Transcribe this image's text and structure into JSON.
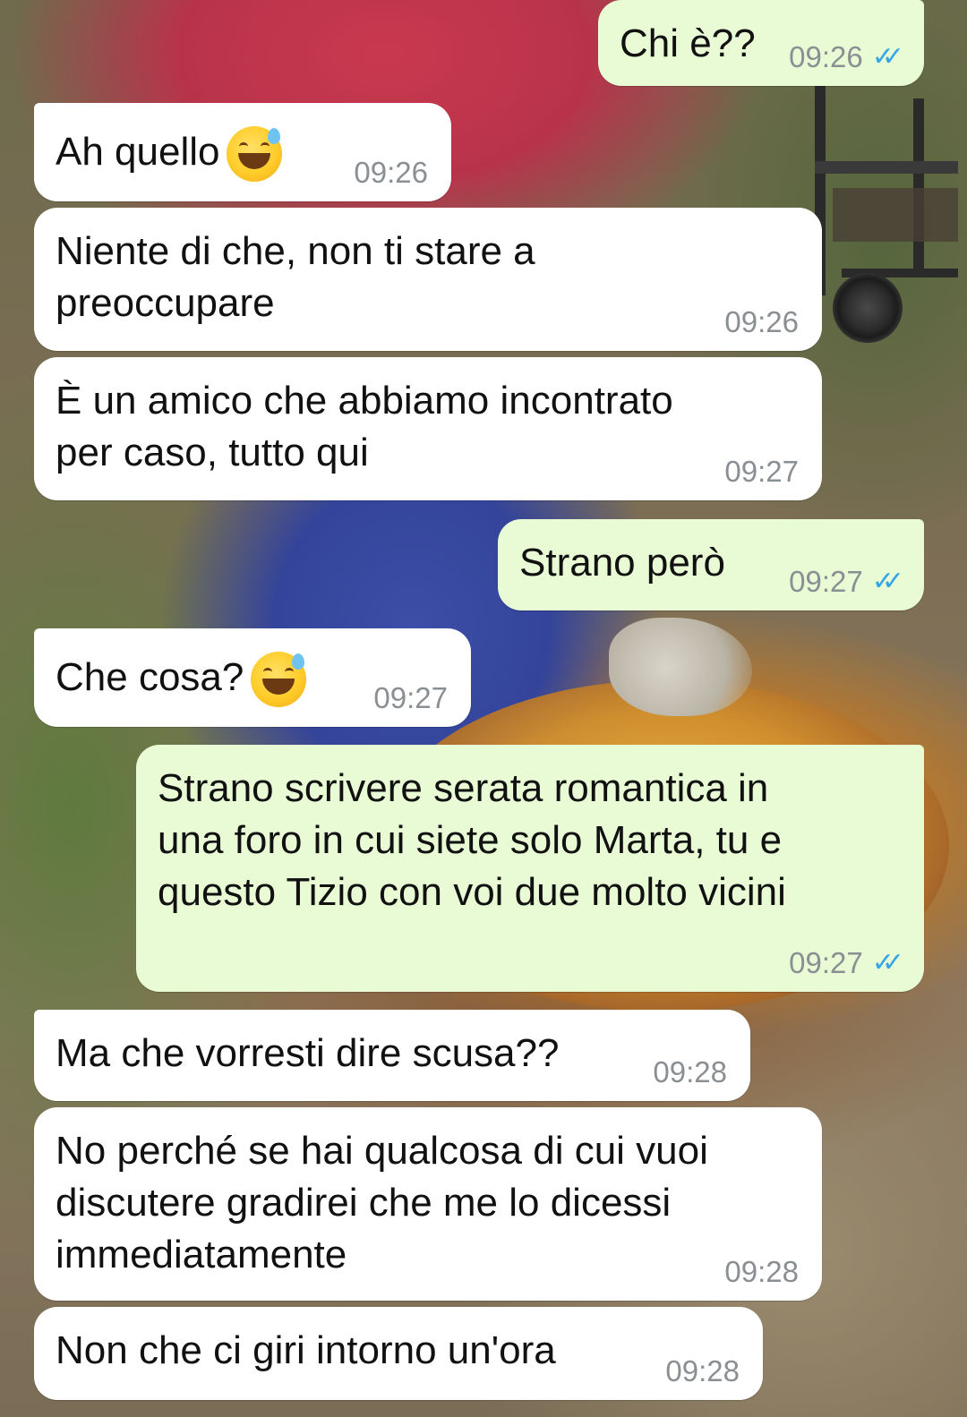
{
  "messages": [
    {
      "direction": "out",
      "text": "Chi è??",
      "time": "09:26",
      "ticks": "✓✓"
    },
    {
      "direction": "in",
      "text": "Ah quello",
      "emoji": "grinning-sweat-emoji",
      "time": "09:26"
    },
    {
      "direction": "in",
      "text": "Niente di che, non ti stare a\npreoccupare",
      "time": "09:26"
    },
    {
      "direction": "in",
      "text": "È un amico che abbiamo incontrato\nper caso, tutto qui",
      "time": "09:27"
    },
    {
      "direction": "out",
      "text": "Strano però",
      "time": "09:27",
      "ticks": "✓✓"
    },
    {
      "direction": "in",
      "text": "Che cosa?",
      "emoji": "grinning-sweat-emoji",
      "time": "09:27"
    },
    {
      "direction": "out",
      "text": "Strano scrivere serata romantica in\nuna foro in cui siete solo Marta, tu e\nquesto Tizio con voi due molto vicini",
      "time": "09:27",
      "ticks": "✓✓"
    },
    {
      "direction": "in",
      "text": "Ma che vorresti dire scusa??",
      "time": "09:28"
    },
    {
      "direction": "in",
      "text": "No perché se hai qualcosa di cui vuoi\ndiscutere gradirei che me lo dicessi\nimmediatamente",
      "time": "09:28"
    },
    {
      "direction": "in",
      "text": "Non che ci giri intorno un'ora",
      "time": "09:28"
    }
  ],
  "colors": {
    "incoming_bubble": "#ffffff",
    "outgoing_bubble": "#e8fbd5",
    "timestamp": "#8a8f93",
    "read_ticks": "#34a6e8"
  }
}
